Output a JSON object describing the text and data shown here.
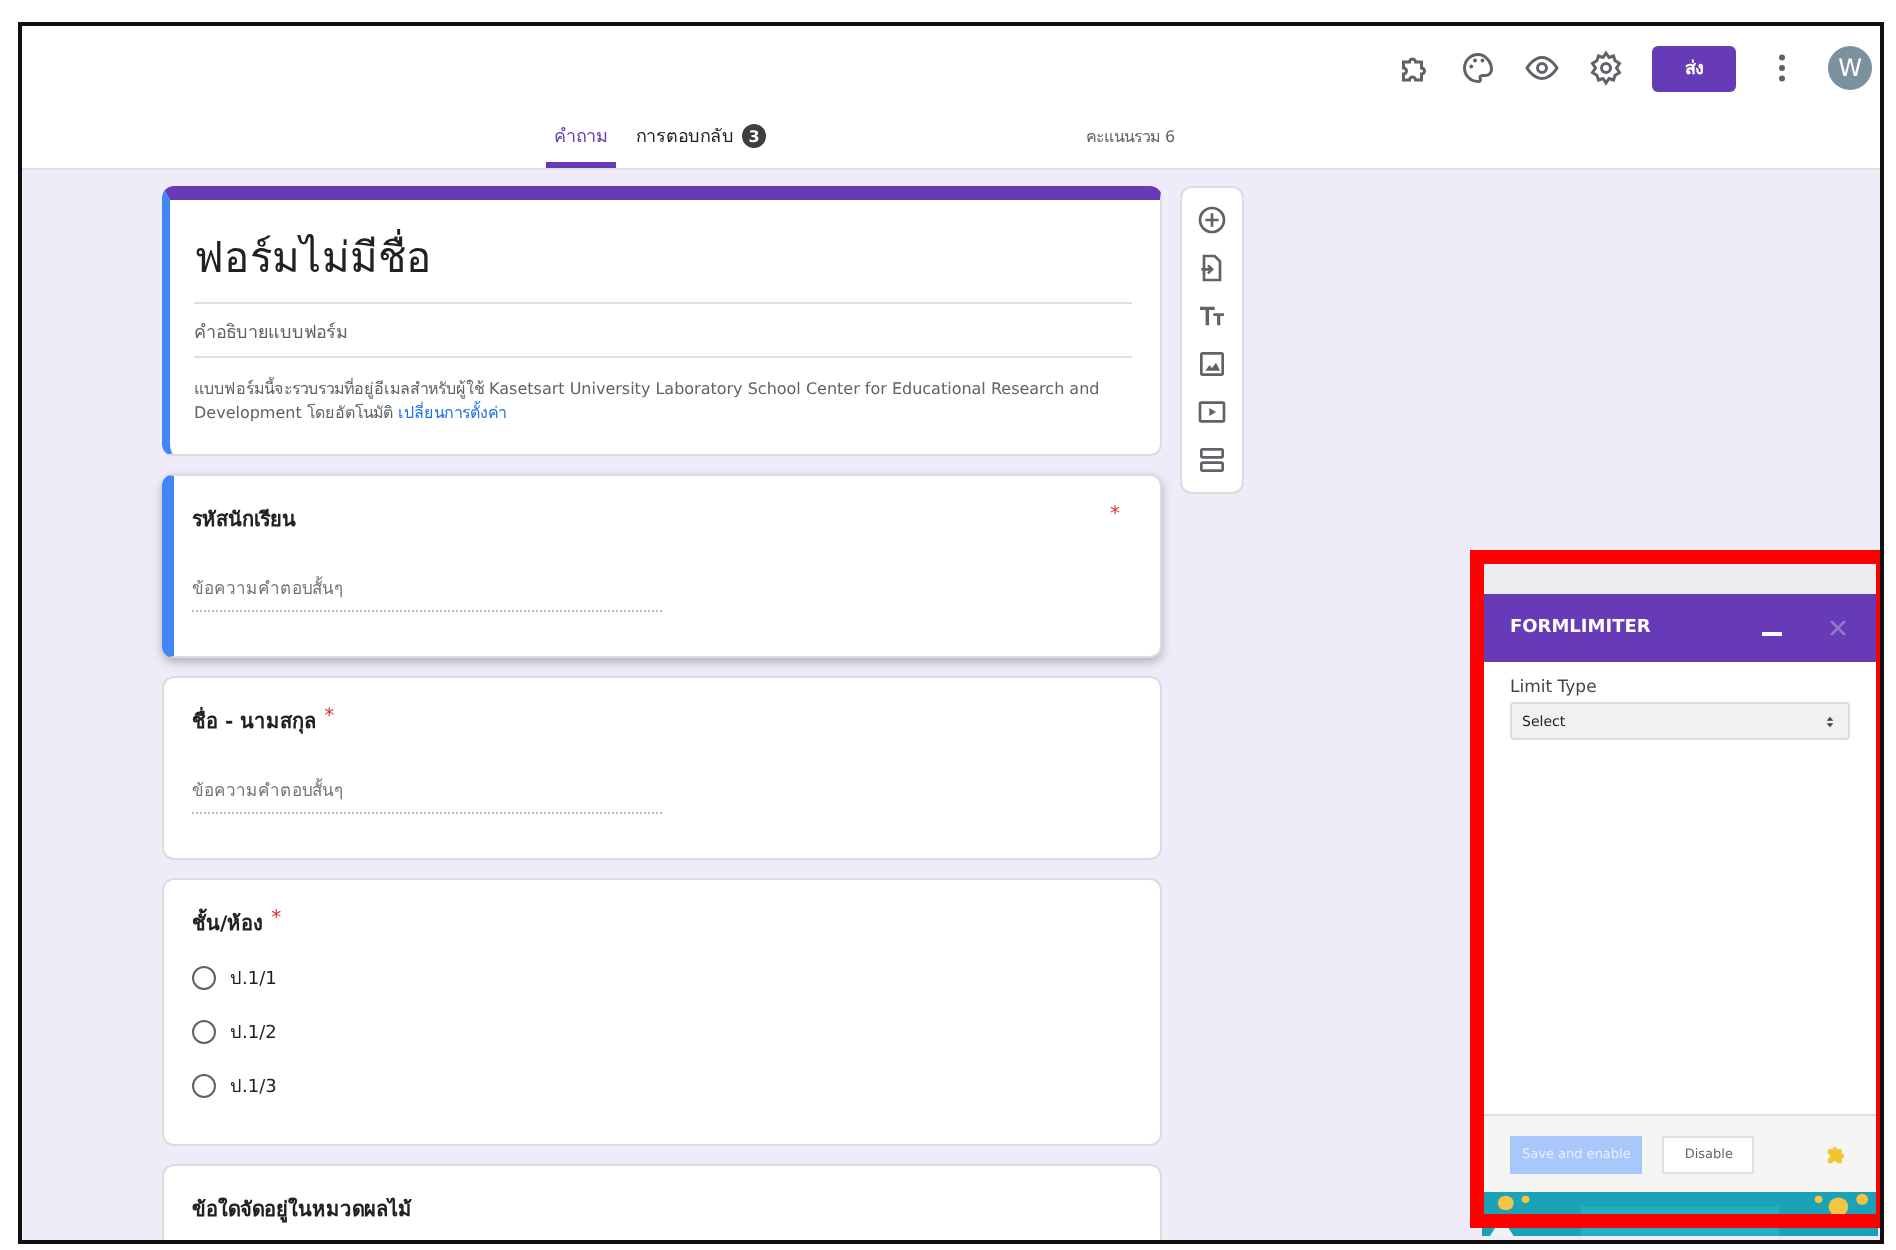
{
  "topbar": {
    "send_button": "ส่ง",
    "avatar": "W"
  },
  "tabs": [
    {
      "label": "คำถาม",
      "selected": true
    },
    {
      "label": "การตอบกลับ",
      "selected": false,
      "badge": "3"
    }
  ],
  "total_score": "คะแนนรวม 6",
  "form": {
    "title": "ฟอร์มไม่มีชื่อ",
    "description_placeholder": "คำอธิบายแบบฟอร์ม",
    "notice": "แบบฟอร์มนี้จะรวบรวมที่อยู่อีเมลสำหรับผู้ใช้ Kasetsart University Laboratory School Center for Educational Research and Development โดยอัตโนมัติ",
    "notice_link": "เปลี่ยนการตั้งค่า"
  },
  "questions": [
    {
      "kind": "short",
      "title": "รหัสนักเรียน",
      "required": "*",
      "selected": true,
      "placeholder": "ข้อความคำตอบสั้นๆ"
    },
    {
      "kind": "short",
      "title": "ชื่อ - นามสกุล",
      "required": "*",
      "selected": false,
      "placeholder": "ข้อความคำตอบสั้นๆ"
    },
    {
      "kind": "choice",
      "title": "ชั้น/ห้อง",
      "required": "*",
      "selected": false,
      "options": [
        {
          "label": "ป.1/1",
          "selected": false
        },
        {
          "label": "ป.1/2",
          "selected": false
        },
        {
          "label": "ป.1/3",
          "selected": false
        }
      ]
    },
    {
      "kind": "heading",
      "title": "ข้อใดจัดอยู่ในหมวดผลไม้",
      "selected": false
    }
  ],
  "addon": {
    "title": "FORMLIMITER",
    "field_label": "Limit Type",
    "select_value": "Select",
    "buttons": [
      {
        "label": "Save and enable",
        "disabled": true
      },
      {
        "label": "Disable",
        "disabled": false
      }
    ]
  }
}
